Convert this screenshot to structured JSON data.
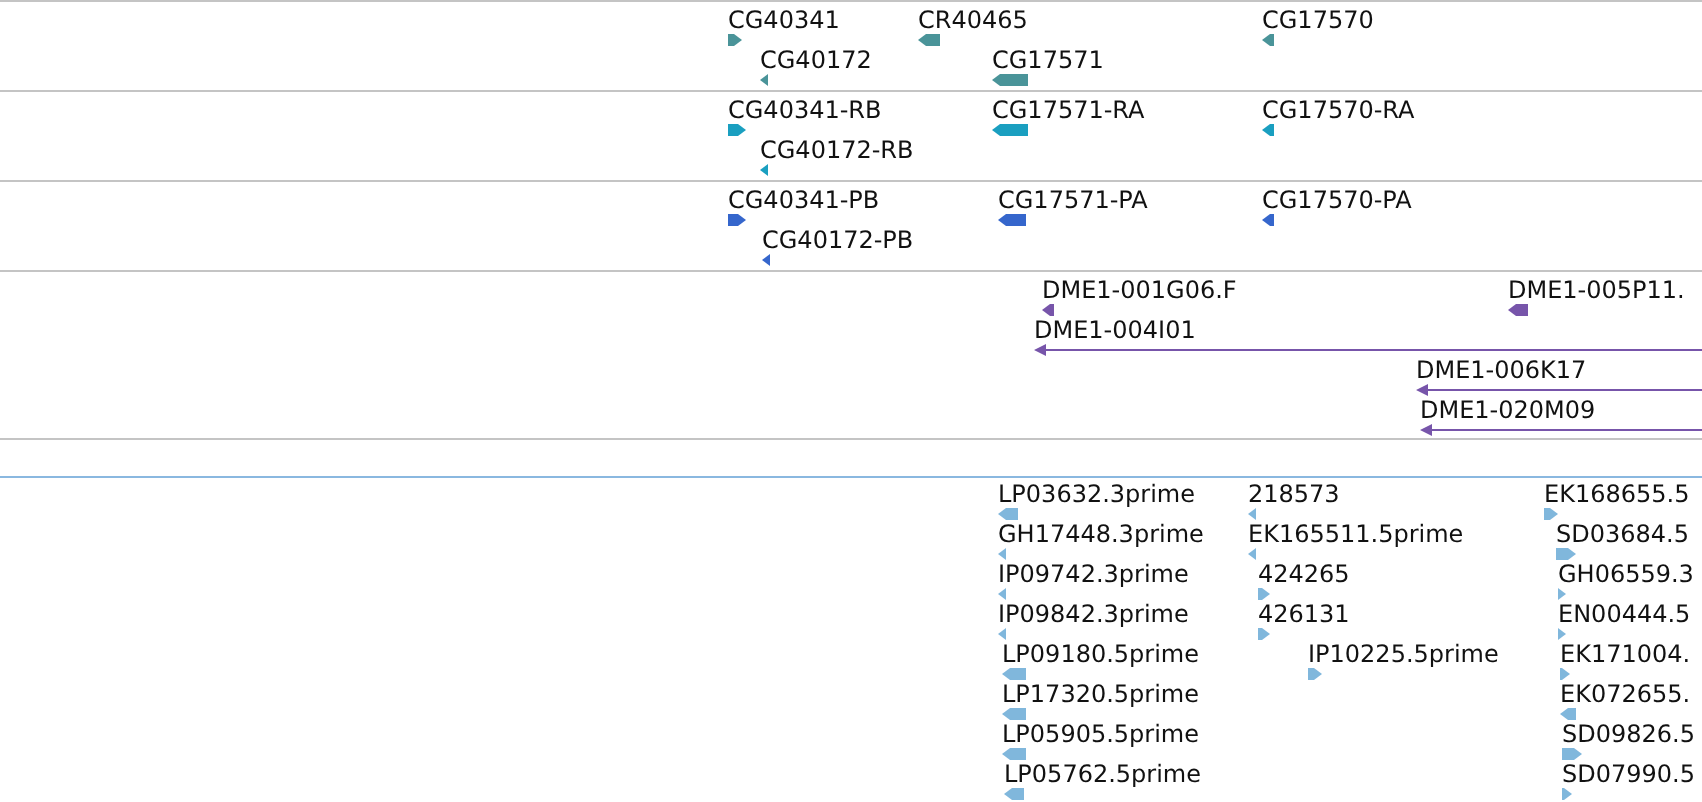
{
  "tracks": [
    {
      "color": "#4a9499",
      "rows": [
        {
          "features": [
            {
              "label": "CG40341",
              "reverse": false,
              "kind": "arrow"
            },
            {
              "label": "CR40465",
              "reverse": true,
              "kind": "arrow"
            },
            {
              "label": "CG17570",
              "reverse": true,
              "kind": "arrow"
            }
          ]
        },
        {
          "features": [
            {
              "label": "CG40172",
              "reverse": true,
              "kind": "arrow"
            },
            {
              "label": "CG17571",
              "reverse": true,
              "kind": "arrow"
            }
          ]
        }
      ]
    },
    {
      "color": "#1a9fc0",
      "rows": [
        {
          "features": [
            {
              "label": "CG40341-RB",
              "reverse": false,
              "kind": "arrow"
            },
            {
              "label": "CG17571-RA",
              "reverse": true,
              "kind": "arrow"
            },
            {
              "label": "CG17570-RA",
              "reverse": true,
              "kind": "arrow"
            }
          ]
        },
        {
          "features": [
            {
              "label": "CG40172-RB",
              "reverse": true,
              "kind": "arrow"
            }
          ]
        }
      ]
    },
    {
      "color": "#3566cc",
      "rows": [
        {
          "features": [
            {
              "label": "CG40341-PB",
              "reverse": false,
              "kind": "arrow"
            },
            {
              "label": "CG17571-PA",
              "reverse": true,
              "kind": "arrow"
            },
            {
              "label": "CG17570-PA",
              "reverse": true,
              "kind": "arrow"
            }
          ]
        },
        {
          "features": [
            {
              "label": "CG40172-PB",
              "reverse": true,
              "kind": "arrow"
            }
          ]
        }
      ]
    },
    {
      "color": "#7755aa",
      "rows": [
        {
          "features": [
            {
              "label": "DME1-001G06.F",
              "reverse": true,
              "kind": "arrow"
            },
            {
              "label": "DME1-005P11.",
              "reverse": true,
              "kind": "arrow"
            }
          ]
        },
        {
          "features": [
            {
              "label": "DME1-004I01",
              "reverse": true,
              "kind": "line"
            }
          ]
        },
        {
          "features": [
            {
              "label": "DME1-006K17",
              "reverse": true,
              "kind": "line"
            }
          ]
        },
        {
          "features": [
            {
              "label": "DME1-020M09",
              "reverse": true,
              "kind": "line"
            }
          ]
        }
      ]
    },
    {
      "color": "#80b7dc",
      "rows": [
        {
          "features": [
            {
              "label": "LP03632.3prime",
              "reverse": true,
              "kind": "arrow"
            },
            {
              "label": "218573",
              "reverse": true,
              "kind": "arrow"
            },
            {
              "label": "EK168655.5",
              "reverse": false,
              "kind": "arrow"
            }
          ]
        },
        {
          "features": [
            {
              "label": "GH17448.3prime",
              "reverse": true,
              "kind": "arrow"
            },
            {
              "label": "EK165511.5prime",
              "reverse": true,
              "kind": "arrow"
            },
            {
              "label": "SD03684.5",
              "reverse": false,
              "kind": "arrow"
            }
          ]
        },
        {
          "features": [
            {
              "label": "IP09742.3prime",
              "reverse": true,
              "kind": "arrow"
            },
            {
              "label": "424265",
              "reverse": false,
              "kind": "arrow"
            },
            {
              "label": "GH06559.3",
              "reverse": false,
              "kind": "arrow"
            }
          ]
        },
        {
          "features": [
            {
              "label": "IP09842.3prime",
              "reverse": true,
              "kind": "arrow"
            },
            {
              "label": "426131",
              "reverse": false,
              "kind": "arrow"
            },
            {
              "label": "EN00444.5",
              "reverse": false,
              "kind": "arrow"
            }
          ]
        },
        {
          "features": [
            {
              "label": "LP09180.5prime",
              "reverse": true,
              "kind": "arrow"
            },
            {
              "label": "IP10225.5prime",
              "reverse": false,
              "kind": "arrow"
            },
            {
              "label": "EK171004.",
              "reverse": false,
              "kind": "arrow"
            }
          ]
        },
        {
          "features": [
            {
              "label": "LP17320.5prime",
              "reverse": true,
              "kind": "arrow"
            },
            {
              "label": "EK072655.",
              "reverse": true,
              "kind": "arrow"
            }
          ]
        },
        {
          "features": [
            {
              "label": "LP05905.5prime",
              "reverse": true,
              "kind": "arrow"
            },
            {
              "label": "SD09826.5",
              "reverse": false,
              "kind": "arrow"
            }
          ]
        },
        {
          "features": [
            {
              "label": "LP05762.5prime",
              "reverse": true,
              "kind": "arrow"
            },
            {
              "label": "SD07990.5",
              "reverse": false,
              "kind": "arrow"
            }
          ]
        }
      ]
    }
  ]
}
